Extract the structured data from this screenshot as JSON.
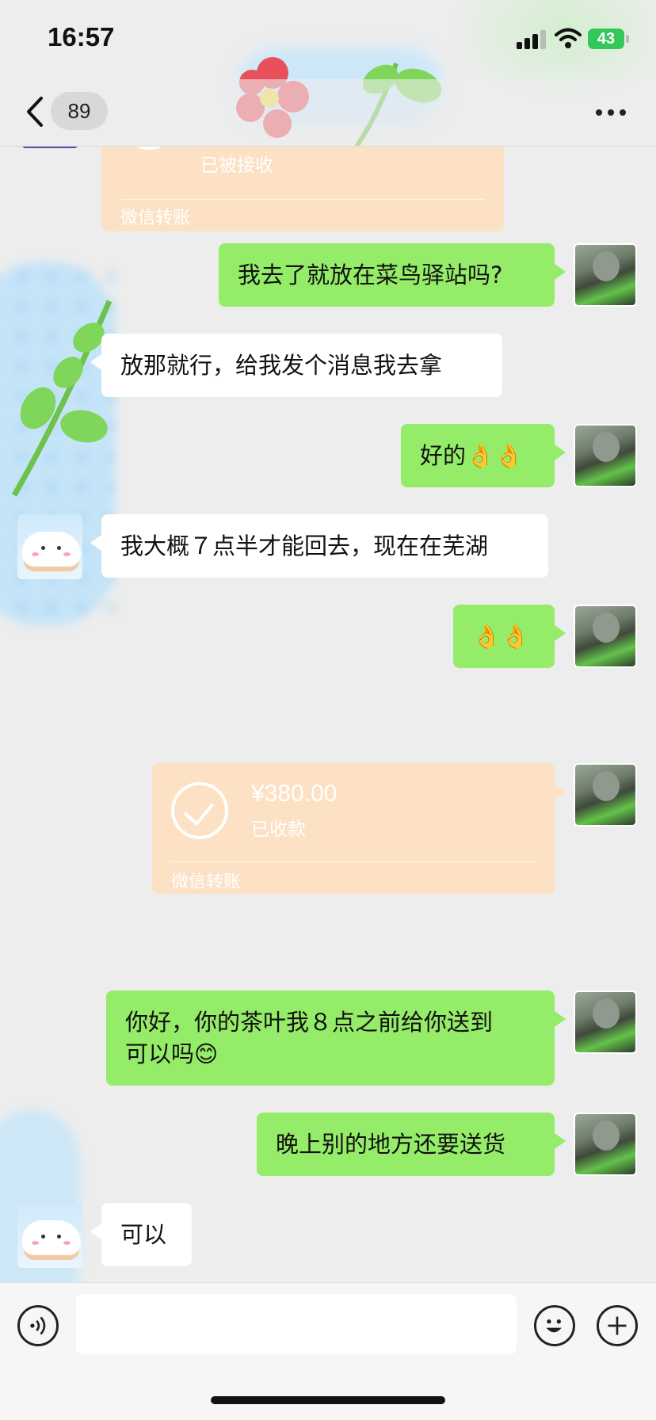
{
  "status_bar": {
    "time": "16:57",
    "battery_level": "43"
  },
  "nav": {
    "unread_count": "89"
  },
  "colors": {
    "my_bubble": "#95ec69",
    "other_bubble": "#ffffff",
    "transfer_card": "#fde1c4",
    "background": "#ededed"
  },
  "messages": [
    {
      "sender": "other",
      "type": "transfer",
      "status": "已被接收",
      "footer": "微信转账"
    },
    {
      "sender": "me",
      "type": "text",
      "text": "我去了就放在菜鸟驿站吗?"
    },
    {
      "sender": "other",
      "type": "text",
      "text": "放那就行，给我发个消息我去拿"
    },
    {
      "sender": "me",
      "type": "text",
      "text": "好的👌👌"
    },
    {
      "sender": "other",
      "type": "text",
      "text": "我大概７点半才能回去，现在在芜湖"
    },
    {
      "sender": "me",
      "type": "text",
      "text": "👌👌"
    },
    {
      "sender": "me",
      "type": "transfer",
      "amount": "¥380.00",
      "status": "已收款",
      "footer": "微信转账"
    },
    {
      "sender": "me",
      "type": "text",
      "lines": [
        "你好，你的茶叶我８点之前给你送到",
        "可以吗😊"
      ]
    },
    {
      "sender": "me",
      "type": "text",
      "text": "晚上别的地方还要送货"
    },
    {
      "sender": "other",
      "type": "text",
      "text": "可以"
    }
  ],
  "input": {
    "value": "",
    "icons": [
      "voice-icon",
      "emoji-icon",
      "plus-icon"
    ]
  }
}
